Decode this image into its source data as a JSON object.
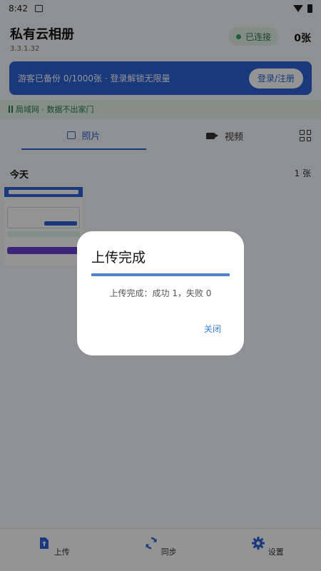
{
  "status_bar": {
    "time": "8:42"
  },
  "header": {
    "title": "私有云相册",
    "version": "3.3.1.32",
    "connection_status": "已连接",
    "photo_count": "0张"
  },
  "banner": {
    "text": "游客已备份 0/1000张 · 登录解锁无限量",
    "button_label": "登录/注册"
  },
  "lan_notice": "局域网 · 数据不出家门",
  "tabs": [
    {
      "label": "照片",
      "icon": "photo-icon",
      "active": true
    },
    {
      "label": "视频",
      "icon": "video-icon",
      "active": false
    }
  ],
  "section": {
    "title": "今天",
    "count": "1 张"
  },
  "bottom_nav": [
    {
      "label": "上传",
      "icon": "upload-icon"
    },
    {
      "label": "同步",
      "icon": "sync-icon"
    },
    {
      "label": "设置",
      "icon": "gear-icon"
    }
  ],
  "dialog": {
    "title": "上传完成",
    "message": "上传完成：成功 1，失败 0",
    "close_label": "关闭",
    "progress": 1.0
  },
  "colors": {
    "accent": "#2b63d6",
    "success": "#2fa866",
    "dialog_bar": "#4a86cf"
  }
}
